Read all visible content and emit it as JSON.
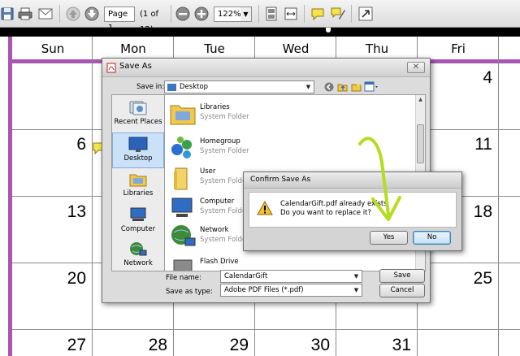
{
  "toolbar": {
    "page_field": "Page 1",
    "page_count": "(1 of 12)",
    "zoom_field": "122%"
  },
  "calendar": {
    "day_names": [
      "Sun",
      "Mon",
      "Tue",
      "Wed",
      "Thu",
      "Fri"
    ],
    "dates": {
      "r1_fri": "4",
      "r2_sun": "6",
      "r2_fri": "11",
      "r3_sun": "13",
      "r3_fri": "18",
      "r4_sun": "20",
      "r4_fri": "25",
      "r5_sun": "27",
      "r5_mon": "28",
      "r5_tue": "29",
      "r5_wed": "30",
      "r5_thu": "31"
    },
    "colors": {
      "accent": "#a956b2"
    }
  },
  "save_as": {
    "title": "Save As",
    "save_in_label": "Save in:",
    "save_in_value": "Desktop",
    "places": [
      {
        "label": "Recent Places"
      },
      {
        "label": "Desktop"
      },
      {
        "label": "Libraries"
      },
      {
        "label": "Computer"
      },
      {
        "label": "Network"
      }
    ],
    "files": [
      {
        "name": "Libraries",
        "type": "System Folder"
      },
      {
        "name": "Homegroup",
        "type": "System Folder"
      },
      {
        "name": "User",
        "type": "System Folder"
      },
      {
        "name": "Computer",
        "type": "System Folder"
      },
      {
        "name": "Network",
        "type": "System Folder"
      },
      {
        "name": "Flash Drive",
        "type": ""
      }
    ],
    "filename_label": "File name:",
    "filename_value": "CalendarGift",
    "savetype_label": "Save as type:",
    "savetype_value": "Adobe PDF Files (*.pdf)",
    "save_button": "Save",
    "cancel_button": "Cancel"
  },
  "confirm": {
    "title": "Confirm Save As",
    "line1": "CalendarGift.pdf already exists.",
    "line2": "Do you want to replace it?",
    "yes_button": "Yes",
    "no_button": "No"
  }
}
